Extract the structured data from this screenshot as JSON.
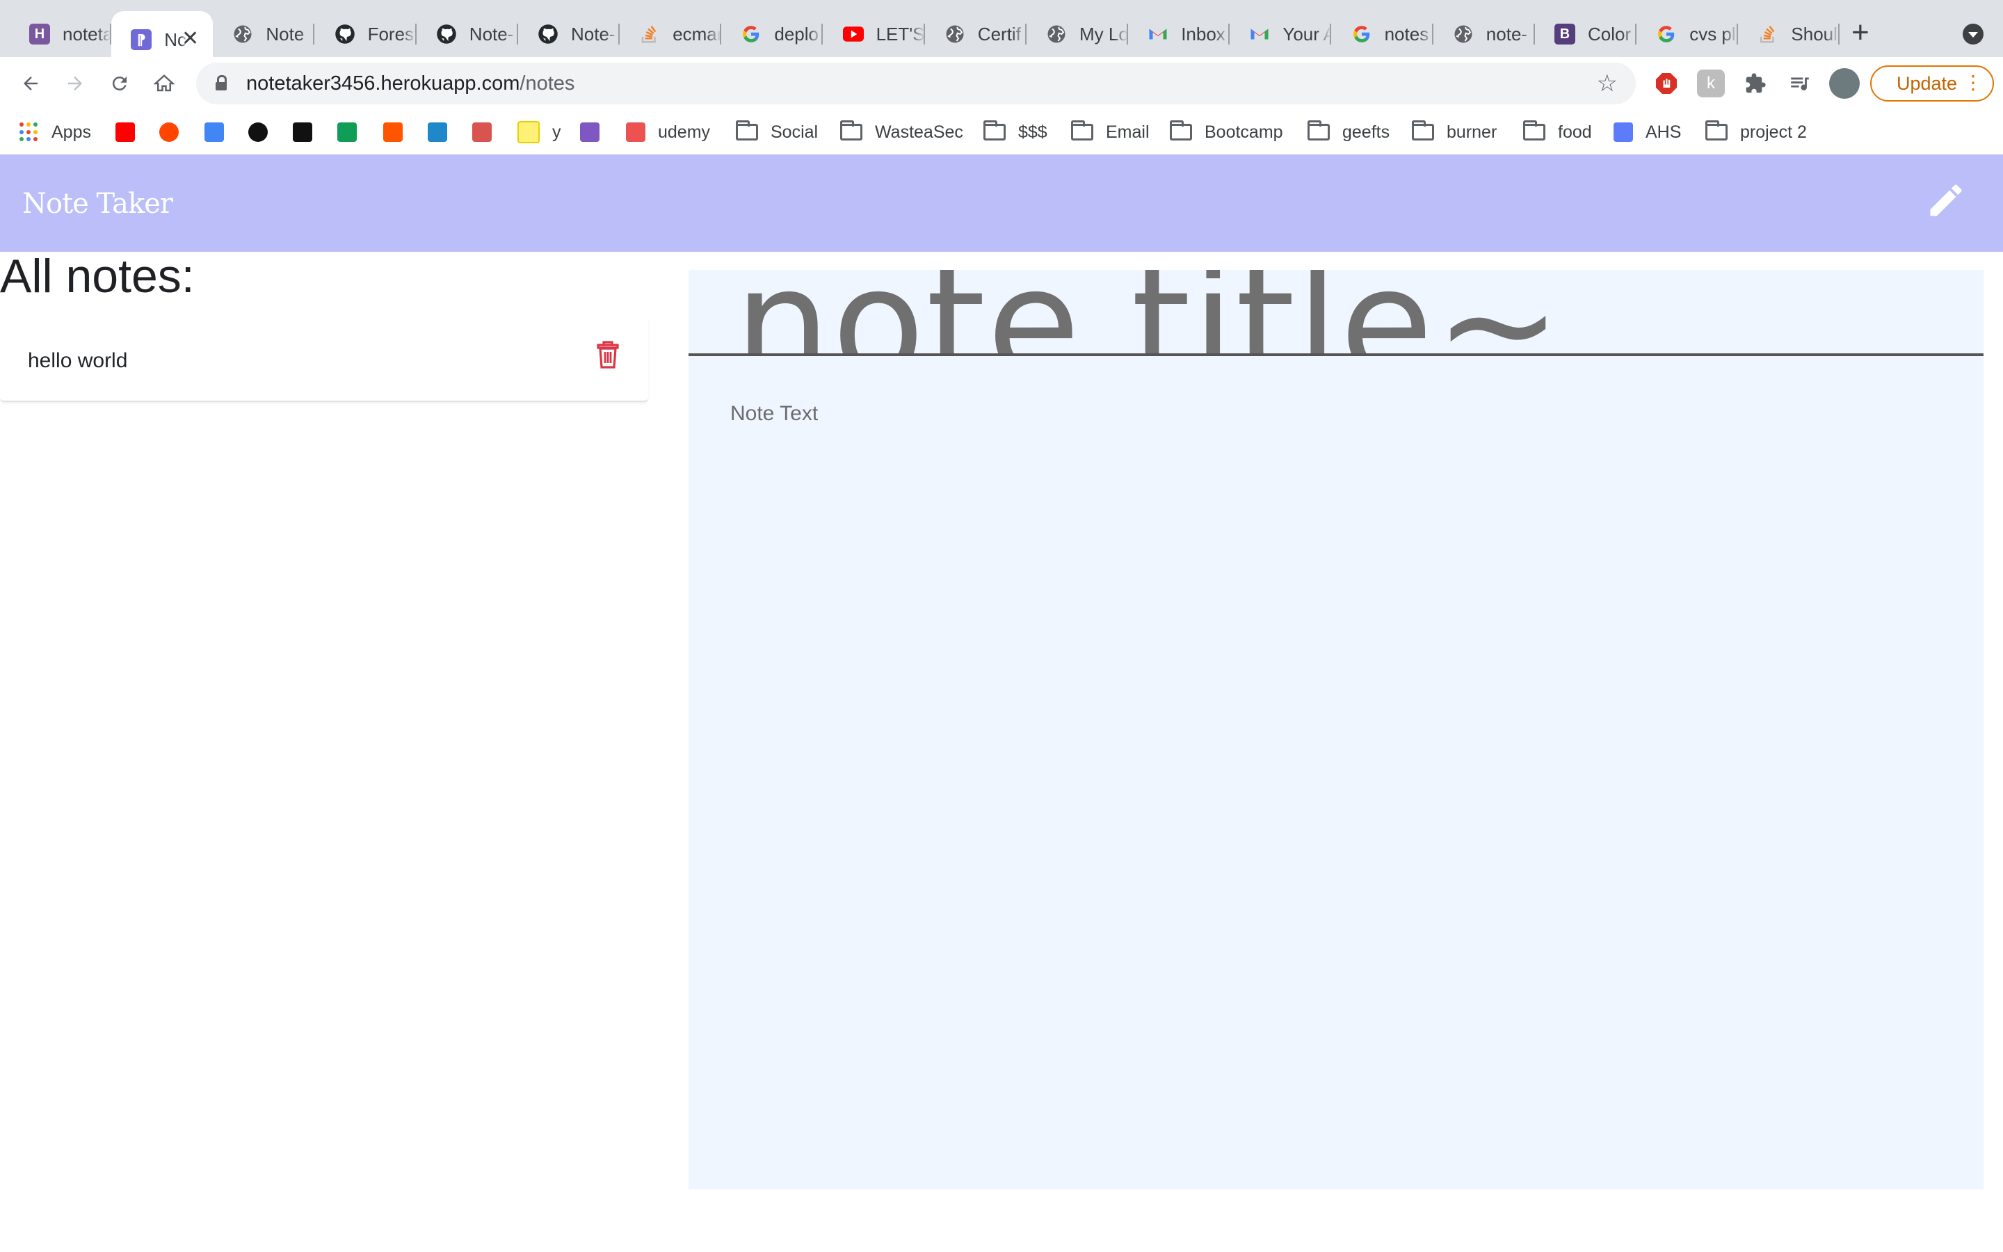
{
  "browser": {
    "tabs": [
      {
        "label": "noteta",
        "favicon": "heroku-icon",
        "color": "#79589f"
      },
      {
        "label": "Nc",
        "favicon": "app-icon",
        "color": "#6f6ad8",
        "active": true
      },
      {
        "label": "Note",
        "favicon": "globe-icon",
        "color": "#5f6368"
      },
      {
        "label": "Forest",
        "favicon": "github-icon",
        "color": "#24292e"
      },
      {
        "label": "Note-",
        "favicon": "github-icon",
        "color": "#24292e"
      },
      {
        "label": "Note-",
        "favicon": "github-icon",
        "color": "#24292e"
      },
      {
        "label": "ecmar",
        "favicon": "stackoverflow-icon",
        "color": "#f48024"
      },
      {
        "label": "deplo",
        "favicon": "google-icon",
        "color": "#4285f4"
      },
      {
        "label": "LET'S",
        "favicon": "youtube-icon",
        "color": "#ff0000"
      },
      {
        "label": "Certif",
        "favicon": "globe-icon",
        "color": "#5f6368"
      },
      {
        "label": "My Lo",
        "favicon": "globe-icon",
        "color": "#5f6368"
      },
      {
        "label": "Inbox",
        "favicon": "gmail-icon",
        "color": "#ea4335"
      },
      {
        "label": "Your A",
        "favicon": "gmail-icon",
        "color": "#ea4335"
      },
      {
        "label": "notes",
        "favicon": "google-icon",
        "color": "#4285f4"
      },
      {
        "label": "note-",
        "favicon": "globe-icon",
        "color": "#5f6368"
      },
      {
        "label": "Color",
        "favicon": "bootstrap-icon",
        "color": "#563d7c"
      },
      {
        "label": "cvs pl",
        "favicon": "google-icon",
        "color": "#4285f4"
      },
      {
        "label": "Shoul",
        "favicon": "stackoverflow-icon",
        "color": "#f48024"
      }
    ],
    "url_host": "notetaker3456.herokuapp.com",
    "url_path": "/notes",
    "update_label": "Update",
    "accent": "#e37400"
  },
  "bookmarks": [
    {
      "label": "Apps",
      "icon": "apps-icon"
    },
    {
      "label": "",
      "icon": "youtube-icon",
      "color": "#ff0000"
    },
    {
      "label": "",
      "icon": "reddit-icon",
      "color": "#ff4500"
    },
    {
      "label": "",
      "icon": "calendar-icon",
      "color": "#4285f4"
    },
    {
      "label": "",
      "icon": "circle-icon",
      "color": "#111111"
    },
    {
      "label": "",
      "icon": "amazon-icon",
      "color": "#111111"
    },
    {
      "label": "",
      "icon": "drive-icon",
      "color": "#0f9d58"
    },
    {
      "label": "",
      "icon": "soundcloud-icon",
      "color": "#ff5500"
    },
    {
      "label": "",
      "icon": "shape-icon",
      "color": "#1e88c8"
    },
    {
      "label": "",
      "icon": "notion-icon",
      "color": "#d9534f"
    },
    {
      "label": "y",
      "icon": "note-icon",
      "color": "#fff176"
    },
    {
      "label": "",
      "icon": "books-icon",
      "color": "#7e57c2"
    },
    {
      "label": "udemy",
      "icon": "udemy-icon",
      "color": "#ec5252"
    },
    {
      "label": "Social",
      "icon": "folder-icon"
    },
    {
      "label": "WasteaSec",
      "icon": "folder-icon"
    },
    {
      "label": "$$$",
      "icon": "folder-icon"
    },
    {
      "label": "Email",
      "icon": "folder-icon"
    },
    {
      "label": "Bootcamp",
      "icon": "folder-icon"
    },
    {
      "label": "geefts",
      "icon": "folder-icon"
    },
    {
      "label": "burner",
      "icon": "folder-icon"
    },
    {
      "label": "food",
      "icon": "folder-icon"
    },
    {
      "label": "AHS",
      "icon": "ahs-icon",
      "color": "#5c7cfa"
    },
    {
      "label": "project 2",
      "icon": "folder-icon"
    }
  ],
  "app": {
    "brand": "Note Taker",
    "nav_color": "#bbbef8",
    "list_heading": "All notes:",
    "notes": [
      {
        "title": "hello world"
      }
    ],
    "delete_color": "#dc3545",
    "editor": {
      "title_value": "note title~",
      "text_placeholder": "Note Text",
      "background": "#eff6ff"
    }
  }
}
